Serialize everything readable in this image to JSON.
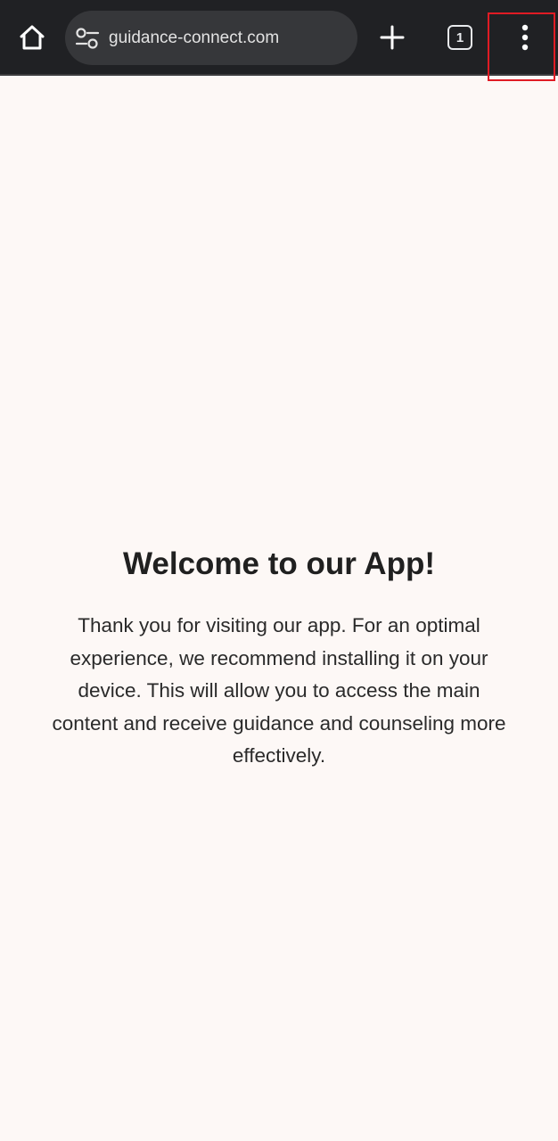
{
  "browser": {
    "url": "guidance-connect.com",
    "tab_count": "1",
    "icons": {
      "home": "home-icon",
      "site_settings": "tune-icon",
      "new_tab": "plus-icon",
      "tabs": "tab-switcher-icon",
      "menu": "more-vert-icon"
    },
    "highlight_color": "#e01b24"
  },
  "page": {
    "heading": "Welcome to our App!",
    "body": "Thank you for visiting our app. For an optimal experience, we recommend installing it on your device. This will allow you to access the main content and receive guidance and counseling more effectively."
  },
  "colors": {
    "toolbar": "#202124",
    "omnibox": "#36373a",
    "page_background": "#fdf8f6",
    "text": "#202020"
  }
}
